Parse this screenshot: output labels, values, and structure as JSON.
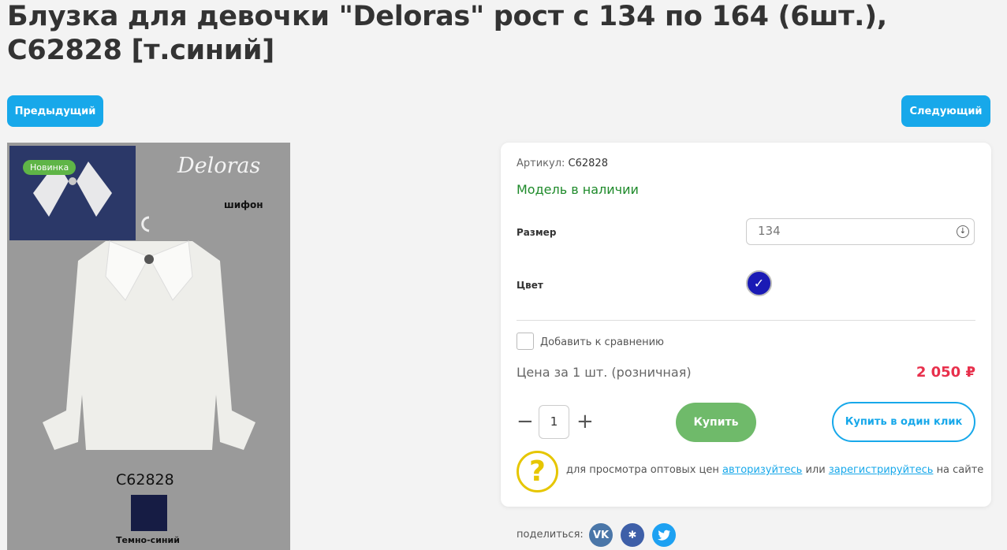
{
  "title": "Блузка для девочки \"Deloras\" рост с 134 по 164 (6шт.), C62828 [т.синий]",
  "nav": {
    "prev_label": "Предыдущий",
    "next_label": "Следующий"
  },
  "photo": {
    "badge": "Новинка",
    "brand": "Deloras",
    "fabric": "шифон",
    "code": "C62828",
    "swatch_label": "Темно-синий",
    "swatch_color": "#161c44"
  },
  "card": {
    "sku_label": "Артикул:",
    "sku_value": "C62828",
    "stock": "Модель в наличии",
    "size_label": "Размер",
    "size_value": "134",
    "color_label": "Цвет",
    "color_value": "#1a1ab5",
    "compare_label": "Добавить к сравнению",
    "price_label": "Цена за 1 шт. (розничная)",
    "price": "2 050 ₽",
    "qty": "1",
    "buy_label": "Купить",
    "buy_one_click_label": "Купить в один клик",
    "wholesale_prefix": "для просмотра оптовых цен",
    "login_link": "авторизуйтесь",
    "or_text": "или",
    "register_link": "зарегистрируйтесь",
    "wholesale_suffix": "на сайте"
  },
  "share": {
    "label": "поделиться:"
  },
  "colors": {
    "accent": "#17a8ea",
    "buy": "#6fba6a",
    "price": "#e8304c",
    "stock": "#1e8a2a"
  }
}
